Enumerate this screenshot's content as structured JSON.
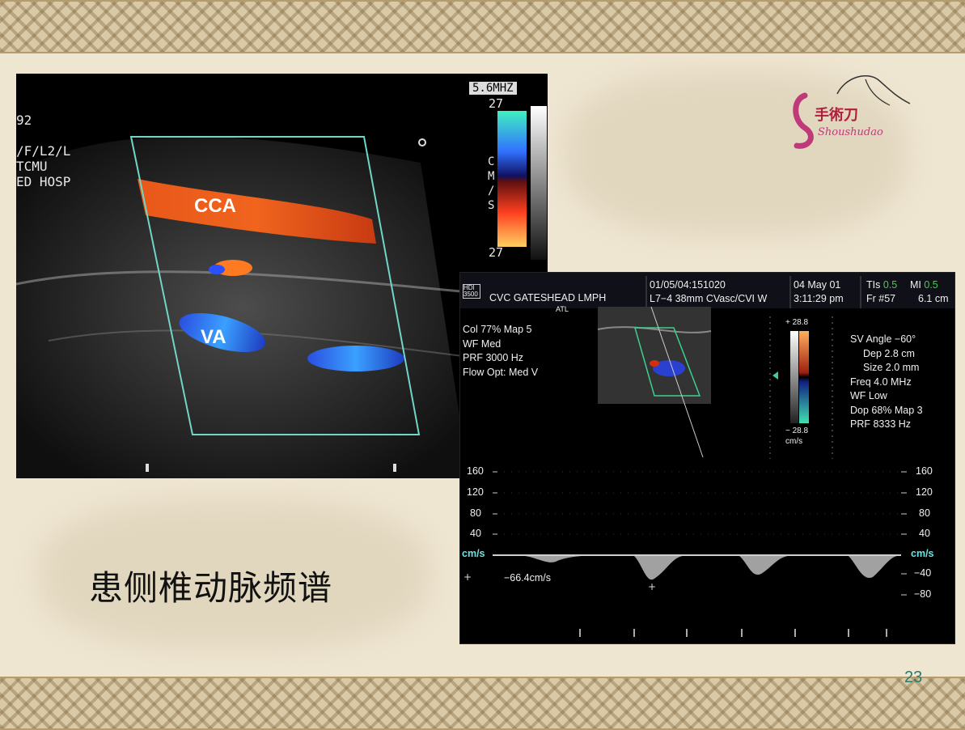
{
  "slide": {
    "caption": "患侧椎动脉频谱",
    "page_number": "23"
  },
  "logo": {
    "char_text": "手術刀",
    "script_text": "Shoushudao"
  },
  "left_image": {
    "freq_label": "5.6MHZ",
    "scale_top": "27",
    "scale_bottom": "27",
    "side_text_lines": [
      "92",
      "/F/L2/L",
      "TCMU",
      "ED HOSP"
    ],
    "right_side_letters": [
      "C",
      "M",
      "/",
      "S"
    ],
    "label_cca": "CCA",
    "label_va": "VA"
  },
  "right_image": {
    "header": {
      "hdi": "HDI 3500",
      "institution": "CVC GATESHEAD LMPH",
      "atl": "ATL",
      "study_id": "01/05/04:151020",
      "probe": "L7−4 38mm CVasc/CVI W",
      "date": "04 May 01",
      "time": "3:11:29 pm",
      "tis_label": "TIs",
      "tis_value": "0.5",
      "mi_label": "MI",
      "mi_value": "0.5",
      "frame": "Fr #57",
      "depth": "6.1 cm"
    },
    "color_params": [
      "Col 77%  Map 5",
      "WF Med",
      "PRF 3000  Hz",
      "Flow Opt: Med V"
    ],
    "scale_max": "+ 28.8",
    "scale_min": "− 28.8",
    "scale_unit": "cm/s",
    "doppler_params": [
      "SV Angle −60°",
      "Dep 2.8  cm",
      "Size 2.0  mm",
      "Freq 4.0  MHz",
      "WF Low",
      "Dop 68%  Map 3",
      "PRF 8333  Hz"
    ],
    "axis_left": [
      "160",
      "120",
      "80",
      "40",
      "cm/s"
    ],
    "axis_right": [
      "160",
      "120",
      "80",
      "40",
      "cm/s",
      "−40",
      "−80"
    ],
    "measurement": "−66.4cm/s"
  }
}
